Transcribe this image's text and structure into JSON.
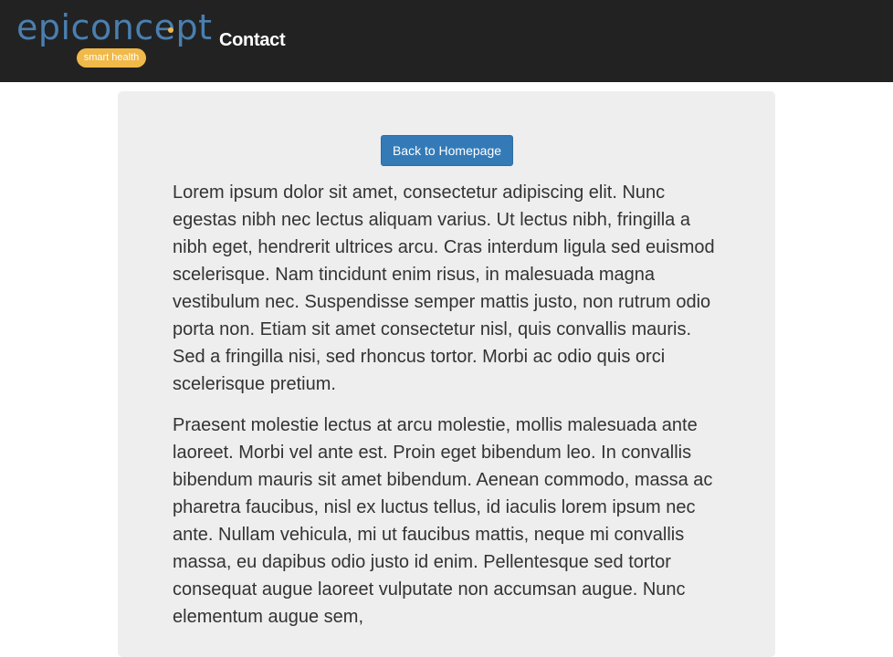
{
  "header": {
    "logo_text": "epiconcept",
    "logo_tagline": "smart health",
    "page_title": "Contact"
  },
  "main": {
    "back_button_label": "Back to Homepage",
    "paragraphs": [
      "Lorem ipsum dolor sit amet, consectetur adipiscing elit. Nunc egestas nibh nec lectus aliquam varius. Ut lectus nibh, fringilla a nibh eget, hendrerit ultrices arcu. Cras interdum ligula sed euismod scelerisque. Nam tincidunt enim risus, in malesuada magna vestibulum nec. Suspendisse semper mattis justo, non rutrum odio porta non. Etiam sit amet consectetur nisl, quis convallis mauris. Sed a fringilla nisi, sed rhoncus tortor. Morbi ac odio quis orci scelerisque pretium.",
      "Praesent molestie lectus at arcu molestie, mollis malesuada ante laoreet. Morbi vel ante est. Proin eget bibendum leo. In convallis bibendum mauris sit amet bibendum. Aenean commodo, massa ac pharetra faucibus, nisl ex luctus tellus, id iaculis lorem ipsum nec ante. Nullam vehicula, mi ut faucibus mattis, neque mi convallis massa, eu dapibus odio justo id enim. Pellentesque sed tortor consequat augue laoreet vulputate non accumsan augue. Nunc elementum augue sem,"
    ]
  },
  "colors": {
    "header_bg": "#222222",
    "logo_blue": "#4a7fb0",
    "logo_accent": "#f0b94a",
    "panel_bg": "#eeeeee",
    "button_bg": "#337ab7",
    "text": "#333333"
  }
}
